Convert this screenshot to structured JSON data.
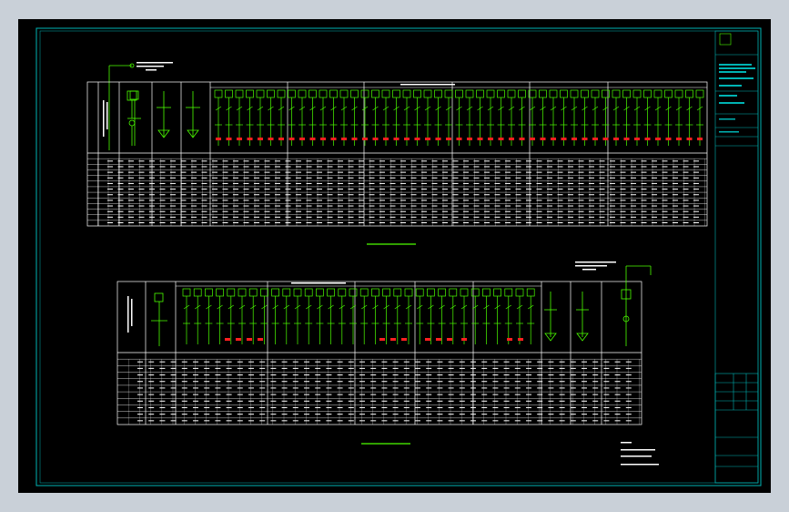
{
  "colors": {
    "background": "#000000",
    "outer_margin": "#c9d0d8",
    "border": "#00b3b3",
    "table_lines": "#ffffff",
    "circuit": "#4cff00",
    "breakers": "#ff2020",
    "title_block": "#00b3b3"
  },
  "drawing": {
    "title_block": {
      "rows": 7
    },
    "lower_right_block": {
      "rows": 5
    }
  }
}
